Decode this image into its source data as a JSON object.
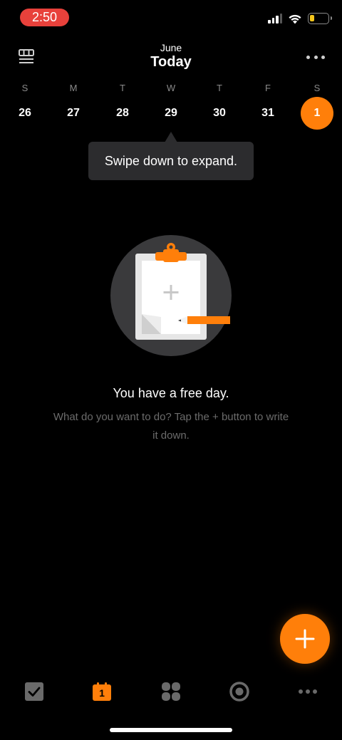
{
  "status": {
    "time": "2:50"
  },
  "header": {
    "month": "June",
    "title": "Today"
  },
  "week": [
    {
      "weekday": "S",
      "date": "26",
      "selected": false
    },
    {
      "weekday": "M",
      "date": "27",
      "selected": false
    },
    {
      "weekday": "T",
      "date": "28",
      "selected": false
    },
    {
      "weekday": "W",
      "date": "29",
      "selected": false
    },
    {
      "weekday": "T",
      "date": "30",
      "selected": false
    },
    {
      "weekday": "F",
      "date": "31",
      "selected": false
    },
    {
      "weekday": "S",
      "date": "1",
      "selected": true
    }
  ],
  "tooltip": {
    "text": "Swipe down to expand."
  },
  "empty": {
    "title": "You have a free day.",
    "description": "What do you want to do? Tap the + button to write it down."
  },
  "tabs": {
    "calendar_day": "1",
    "icons": [
      "checkbox-icon",
      "calendar-icon",
      "grid-icon",
      "focus-icon",
      "more-icon"
    ]
  },
  "colors": {
    "accent": "#ff7f0a",
    "status_pill": "#e8413b",
    "tooltip_bg": "#2c2c2e"
  }
}
